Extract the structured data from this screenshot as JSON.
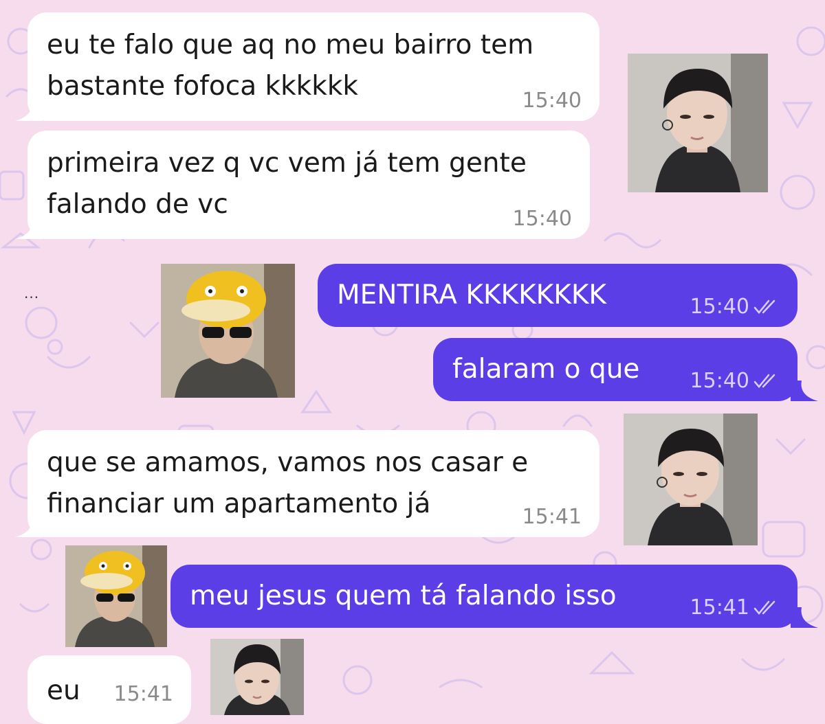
{
  "typing_indicator": "...",
  "messages": [
    {
      "direction": "in",
      "text": "eu te falo que aq no meu bairro tem\nbastante fofoca kkkkkk",
      "time": "15:40"
    },
    {
      "direction": "in",
      "text": "primeira vez q vc vem já tem gente\nfalando de vc",
      "time": "15:40"
    },
    {
      "direction": "out",
      "text": "MENTIRA KKKKKKKK",
      "time": "15:40",
      "status": "read-double-check-icon"
    },
    {
      "direction": "out",
      "text": "falaram o que",
      "time": "15:40",
      "status": "read-double-check-icon"
    },
    {
      "direction": "in",
      "text": "que se amamos, vamos nos casar e\nfinanciar um apartamento já",
      "time": "15:41"
    },
    {
      "direction": "out",
      "text": "meu jesus quem tá falando isso",
      "time": "15:41",
      "status": "read-double-check-icon"
    },
    {
      "direction": "in",
      "text": "eu",
      "time": "15:41"
    }
  ],
  "colors": {
    "wallpaper": "#f6dcec",
    "wallpaper_doodles": "#dcc6ee",
    "incoming_bubble": "#ffffff",
    "outgoing_bubble": "#5b3ee6",
    "timestamp_incoming": "#8a8a8a",
    "timestamp_outgoing": "#d9d1ff"
  }
}
